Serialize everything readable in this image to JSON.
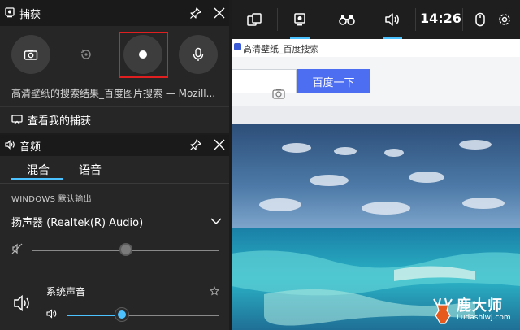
{
  "browser": {
    "tab_title": "高清壁纸_百度搜索",
    "search_button": "百度一下"
  },
  "game_bar": {
    "clock": "14:26",
    "buttons": [
      "widget-menu-icon",
      "capture-icon",
      "performance-icon",
      "audio-icon",
      "mouse-icon",
      "settings-icon"
    ],
    "accent_color": "#4cc2ff"
  },
  "capture": {
    "title": "捕获",
    "buttons": [
      "screenshot-icon",
      "record-last-icon",
      "record-icon",
      "mic-icon"
    ],
    "source": "高清壁纸的搜索结果_百度图片搜索 — Mozill...",
    "see_captures": "查看我的捕获"
  },
  "audio": {
    "title": "音频",
    "tabs": [
      "混合",
      "语音"
    ],
    "active_tab": "混合",
    "output_label": "WINDOWS 默认输出",
    "device": "扬声器 (Realtek(R) Audio)",
    "device_volume_fraction": 0.5,
    "app_label": "系统声音",
    "app_volume_fraction": 0.36
  },
  "watermark": {
    "main": "鹿大师",
    "sub": "Ludashiwj.com"
  }
}
